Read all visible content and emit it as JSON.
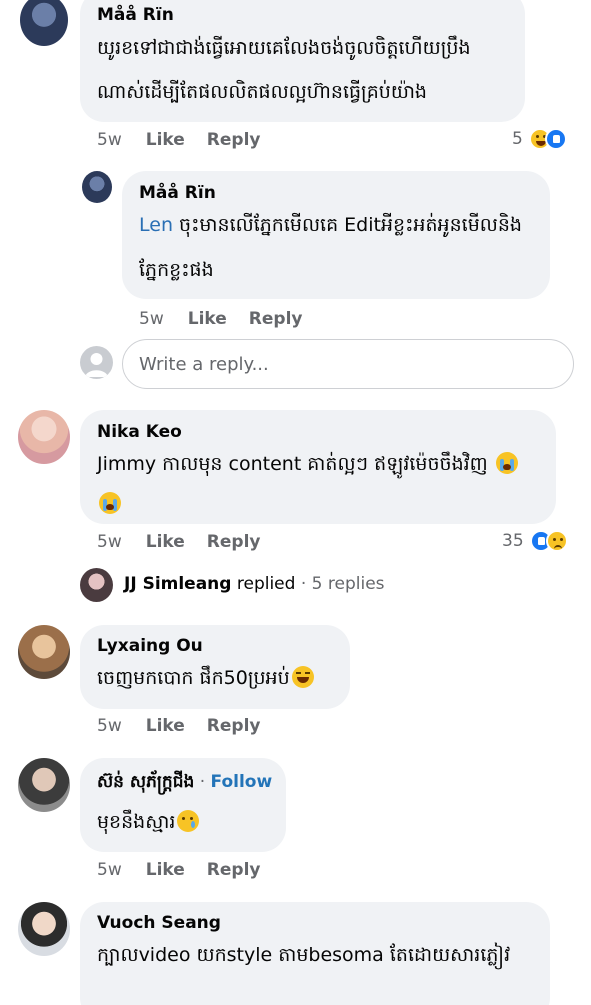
{
  "comments": [
    {
      "name": "Måå Rïn",
      "lines": [
        "យូរខទៅជាជាង់ធ្វើអោយគេលែងចង់ចូលចិត្តហើយប្រឹង",
        "ណាស់ដើម្បីតែផលលិតផលល្អហ៊ានធ្វើគ្រប់យ៉ាង"
      ],
      "time": "5w",
      "like": "Like",
      "reply": "Reply",
      "reaction_count": "5",
      "reactions": [
        "haha",
        "like"
      ]
    },
    {
      "name": "Måå Rïn",
      "mention": "Len",
      "lines": [
        " ចុះមានលើភ្នែកមើលគេ Editអីខ្លះអត់អូនមើលនិង",
        "ភ្នែកខ្លះផង"
      ],
      "time": "5w",
      "like": "Like",
      "reply": "Reply"
    },
    {
      "name": "Nika Keo",
      "lines": [
        "Jimmy កាលមុន content គាត់ល្អៗ ឥឡូវម៉េចចឹងវិញ"
      ],
      "time": "5w",
      "like": "Like",
      "reply": "Reply",
      "reaction_count": "35",
      "reactions": [
        "like",
        "sad"
      ]
    },
    {
      "name": "Lyxaing Ou",
      "lines": [
        "ចេញមកបោក ផឹក50ប្រអប់"
      ],
      "time": "5w",
      "like": "Like",
      "reply": "Reply"
    },
    {
      "name": "ស៊ន់ សុភ័ក្រ្តជីង",
      "follow": "Follow",
      "lines": [
        "មុខនឹងស្មារ"
      ],
      "time": "5w",
      "like": "Like",
      "reply": "Reply"
    },
    {
      "name": "Vuoch Seang",
      "lines": [
        "ក្បាលvideo យកstyle តាមbesoma តែដោយសារភ្លៀវ"
      ]
    }
  ],
  "reply_box": {
    "placeholder": "Write a reply..."
  },
  "replied": {
    "name": "JJ Simleang",
    "action": "replied",
    "separator": " · ",
    "count": "5 replies"
  },
  "colors": {
    "bubble": "#f0f2f5",
    "link": "#2374b8",
    "muted": "#65676b"
  },
  "icons": [
    "user-placeholder-icon",
    "haha-reaction-icon",
    "like-reaction-icon",
    "sad-reaction-icon",
    "crying-emoji",
    "laughing-emoji",
    "tear-emoji"
  ]
}
